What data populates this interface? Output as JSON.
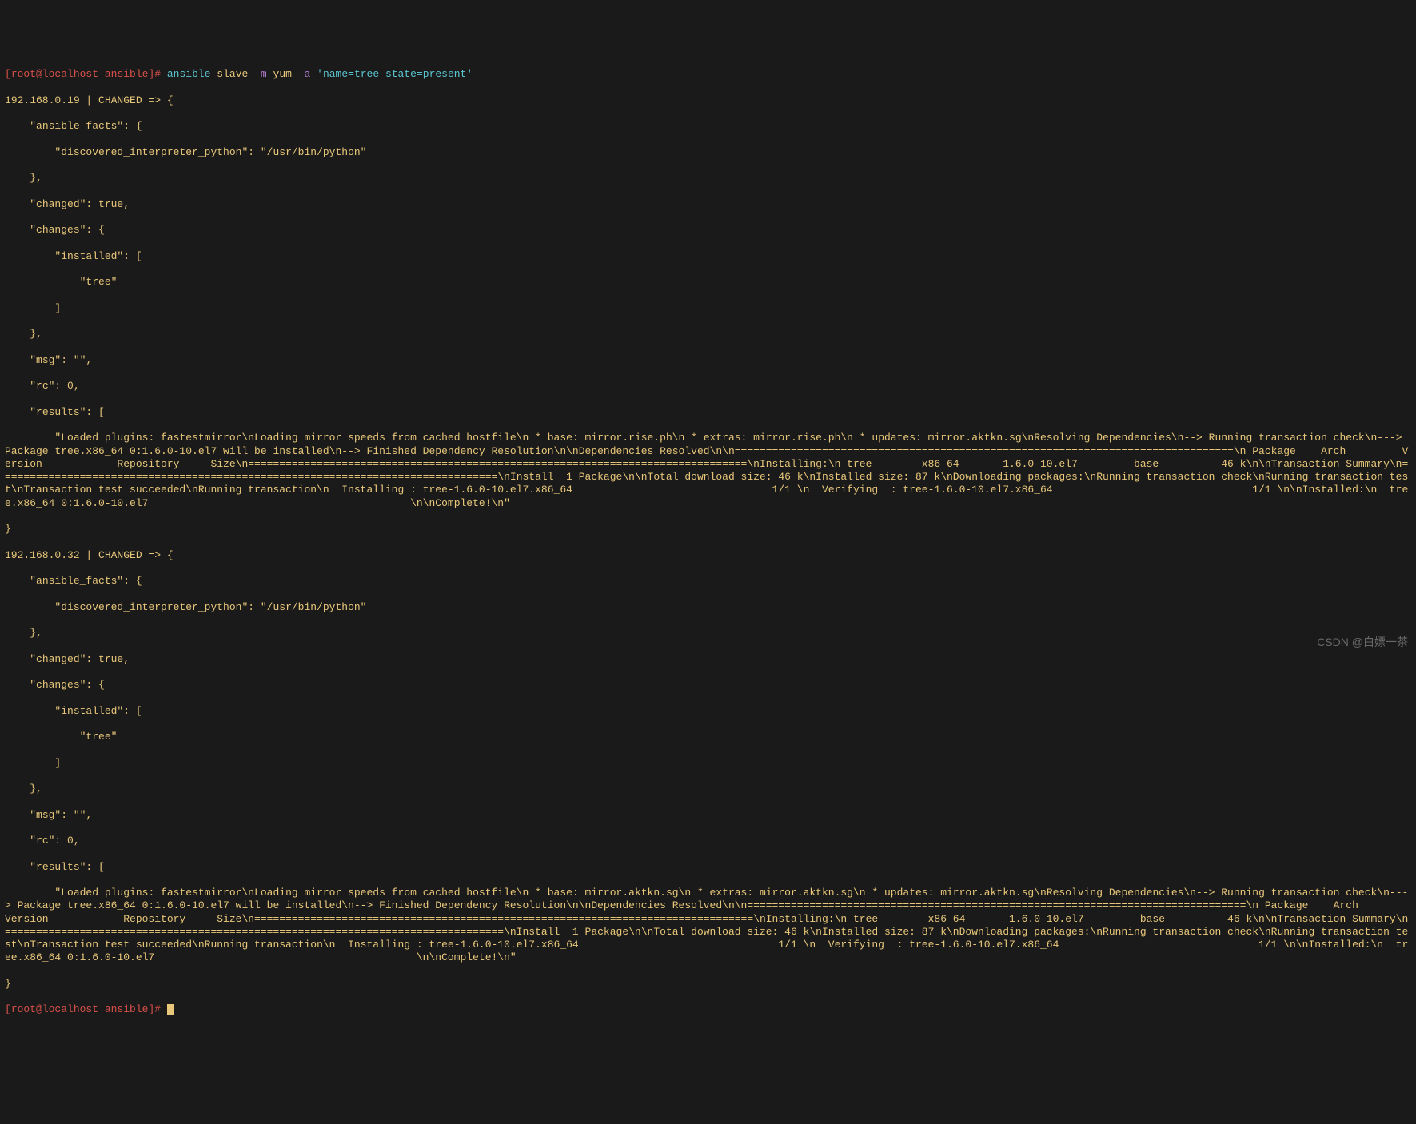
{
  "prompt1": {
    "bracket_open": "[",
    "user_host": "root@localhost ",
    "dir": "ansible",
    "bracket_close": "]",
    "hash": "# ",
    "cmd_ansible": "ansible ",
    "cmd_target": "slave ",
    "flag_m": "-m ",
    "cmd_module": "yum ",
    "flag_a": "-a ",
    "cmd_args": "'name=tree state=present'"
  },
  "host1": {
    "header": "192.168.0.19 | CHANGED => {",
    "facts_open": "    \"ansible_facts\": {",
    "interp": "        \"discovered_interpreter_python\": \"/usr/bin/python\"",
    "facts_close": "    },",
    "changed": "    \"changed\": true,",
    "changes_open": "    \"changes\": {",
    "installed_open": "        \"installed\": [",
    "tree": "            \"tree\"",
    "installed_close": "        ]",
    "changes_close": "    },",
    "msg": "    \"msg\": \"\",",
    "rc": "    \"rc\": 0,",
    "results_open": "    \"results\": [",
    "results_body": "        \"Loaded plugins: fastestmirror\\nLoading mirror speeds from cached hostfile\\n * base: mirror.rise.ph\\n * extras: mirror.rise.ph\\n * updates: mirror.aktkn.sg\\nResolving Dependencies\\n--> Running transaction check\\n---> Package tree.x86_64 0:1.6.0-10.el7 will be installed\\n--> Finished Dependency Resolution\\n\\nDependencies Resolved\\n\\n================================================================================\\n Package    Arch         Version            Repository     Size\\n================================================================================\\nInstalling:\\n tree        x86_64       1.6.0-10.el7         base          46 k\\n\\nTransaction Summary\\n================================================================================\\nInstall  1 Package\\n\\nTotal download size: 46 k\\nInstalled size: 87 k\\nDownloading packages:\\nRunning transaction check\\nRunning transaction test\\nTransaction test succeeded\\nRunning transaction\\n  Installing : tree-1.6.0-10.el7.x86_64                                1/1 \\n  Verifying  : tree-1.6.0-10.el7.x86_64                                1/1 \\n\\nInstalled:\\n  tree.x86_64 0:1.6.0-10.el7                                          \\n\\nComplete!\\n\"",
    "close": "}"
  },
  "host2": {
    "header": "192.168.0.32 | CHANGED => {",
    "facts_open": "    \"ansible_facts\": {",
    "interp": "        \"discovered_interpreter_python\": \"/usr/bin/python\"",
    "facts_close": "    },",
    "changed": "    \"changed\": true,",
    "changes_open": "    \"changes\": {",
    "installed_open": "        \"installed\": [",
    "tree": "            \"tree\"",
    "installed_close": "        ]",
    "changes_close": "    },",
    "msg": "    \"msg\": \"\",",
    "rc": "    \"rc\": 0,",
    "results_open": "    \"results\": [",
    "results_body": "        \"Loaded plugins: fastestmirror\\nLoading mirror speeds from cached hostfile\\n * base: mirror.aktkn.sg\\n * extras: mirror.aktkn.sg\\n * updates: mirror.aktkn.sg\\nResolving Dependencies\\n--> Running transaction check\\n---> Package tree.x86_64 0:1.6.0-10.el7 will be installed\\n--> Finished Dependency Resolution\\n\\nDependencies Resolved\\n\\n================================================================================\\n Package    Arch         Version            Repository     Size\\n================================================================================\\nInstalling:\\n tree        x86_64       1.6.0-10.el7         base          46 k\\n\\nTransaction Summary\\n================================================================================\\nInstall  1 Package\\n\\nTotal download size: 46 k\\nInstalled size: 87 k\\nDownloading packages:\\nRunning transaction check\\nRunning transaction test\\nTransaction test succeeded\\nRunning transaction\\n  Installing : tree-1.6.0-10.el7.x86_64                                1/1 \\n  Verifying  : tree-1.6.0-10.el7.x86_64                                1/1 \\n\\nInstalled:\\n  tree.x86_64 0:1.6.0-10.el7                                          \\n\\nComplete!\\n\"",
    "close": "}"
  },
  "prompt2": {
    "bracket_open": "[",
    "user_host": "root@localhost ",
    "dir": "ansible",
    "bracket_close": "]",
    "hash": "# "
  },
  "watermark": "CSDN @白嫖一茶"
}
